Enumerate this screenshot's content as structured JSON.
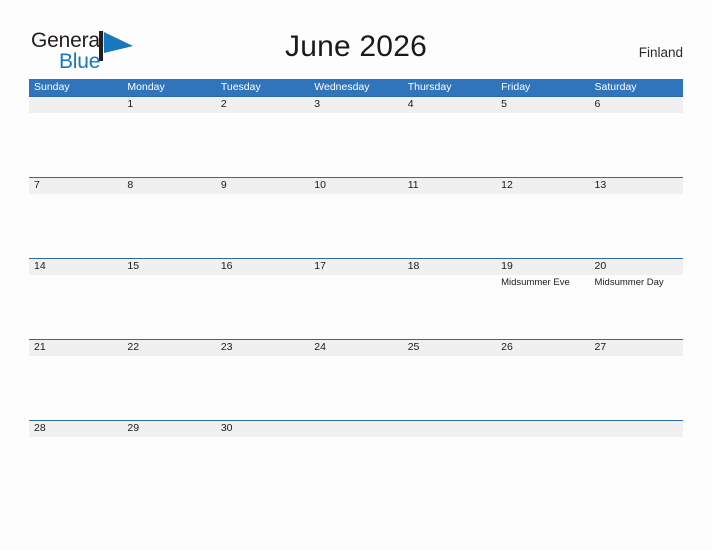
{
  "brand": {
    "name_part1": "General",
    "name_part2": "Blue",
    "flag_icon": "blue-flag-triangle",
    "color_dark": "#231f20",
    "color_blue": "#1878bd"
  },
  "header": {
    "title": "June 2026",
    "region": "Finland",
    "header_bg": "#3075bc",
    "band_bg": "#f0f0f0",
    "rule_color": "#2c6aa8"
  },
  "weekdays": [
    "Sunday",
    "Monday",
    "Tuesday",
    "Wednesday",
    "Thursday",
    "Friday",
    "Saturday"
  ],
  "weeks": [
    [
      {
        "day": "",
        "event": ""
      },
      {
        "day": "1",
        "event": ""
      },
      {
        "day": "2",
        "event": ""
      },
      {
        "day": "3",
        "event": ""
      },
      {
        "day": "4",
        "event": ""
      },
      {
        "day": "5",
        "event": ""
      },
      {
        "day": "6",
        "event": ""
      }
    ],
    [
      {
        "day": "7",
        "event": ""
      },
      {
        "day": "8",
        "event": ""
      },
      {
        "day": "9",
        "event": ""
      },
      {
        "day": "10",
        "event": ""
      },
      {
        "day": "11",
        "event": ""
      },
      {
        "day": "12",
        "event": ""
      },
      {
        "day": "13",
        "event": ""
      }
    ],
    [
      {
        "day": "14",
        "event": ""
      },
      {
        "day": "15",
        "event": ""
      },
      {
        "day": "16",
        "event": ""
      },
      {
        "day": "17",
        "event": ""
      },
      {
        "day": "18",
        "event": ""
      },
      {
        "day": "19",
        "event": "Midsummer Eve"
      },
      {
        "day": "20",
        "event": "Midsummer Day"
      }
    ],
    [
      {
        "day": "21",
        "event": ""
      },
      {
        "day": "22",
        "event": ""
      },
      {
        "day": "23",
        "event": ""
      },
      {
        "day": "24",
        "event": ""
      },
      {
        "day": "25",
        "event": ""
      },
      {
        "day": "26",
        "event": ""
      },
      {
        "day": "27",
        "event": ""
      }
    ],
    [
      {
        "day": "28",
        "event": ""
      },
      {
        "day": "29",
        "event": ""
      },
      {
        "day": "30",
        "event": ""
      },
      {
        "day": "",
        "event": ""
      },
      {
        "day": "",
        "event": ""
      },
      {
        "day": "",
        "event": ""
      },
      {
        "day": "",
        "event": ""
      }
    ]
  ]
}
